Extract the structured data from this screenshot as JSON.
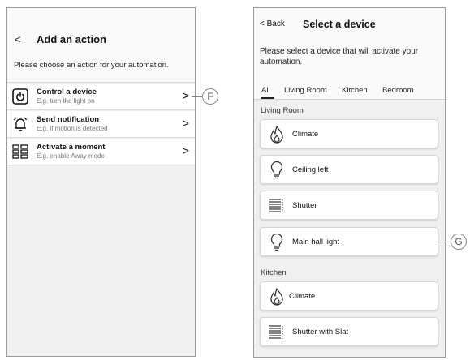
{
  "left_screen": {
    "back_label": "<",
    "title": "Add an action",
    "description": "Please choose an action for your automation.",
    "actions": [
      {
        "title": "Control a device",
        "subtitle": "E.g. turn the light on",
        "icon": "power-icon"
      },
      {
        "title": "Send notification",
        "subtitle": "E.g. if motion is detected",
        "icon": "bell-icon"
      },
      {
        "title": "Activate a moment",
        "subtitle": "E.g. enable Away mode",
        "icon": "grid-moment-icon"
      }
    ],
    "chevron": ">"
  },
  "callouts": {
    "f": "F",
    "g": "G"
  },
  "right_screen": {
    "back_label": "< Back",
    "title": "Select a device",
    "description": "Please select a device that will activate your automation.",
    "tabs": [
      "All",
      "Living Room",
      "Kitchen",
      "Bedroom"
    ],
    "active_tab": "All",
    "sections": [
      {
        "label": "Living Room",
        "devices": [
          {
            "label": "Climate",
            "icon": "flame-icon"
          },
          {
            "label": "Ceiling left",
            "icon": "lightbulb-icon"
          },
          {
            "label": "Shutter",
            "icon": "shutter-icon"
          },
          {
            "label": "Main hall light",
            "icon": "lightbulb-icon"
          }
        ]
      },
      {
        "label": "Kitchen",
        "devices": [
          {
            "label": "Climate",
            "icon": "flame-icon"
          },
          {
            "label": "Shutter with Slat",
            "icon": "shutter-icon"
          }
        ]
      }
    ]
  },
  "colors": {
    "frame_border": "#9a9a9a",
    "panel_bg": "#f0f0f0",
    "header_bg": "#fafafa",
    "callout_gray": "#888888"
  }
}
